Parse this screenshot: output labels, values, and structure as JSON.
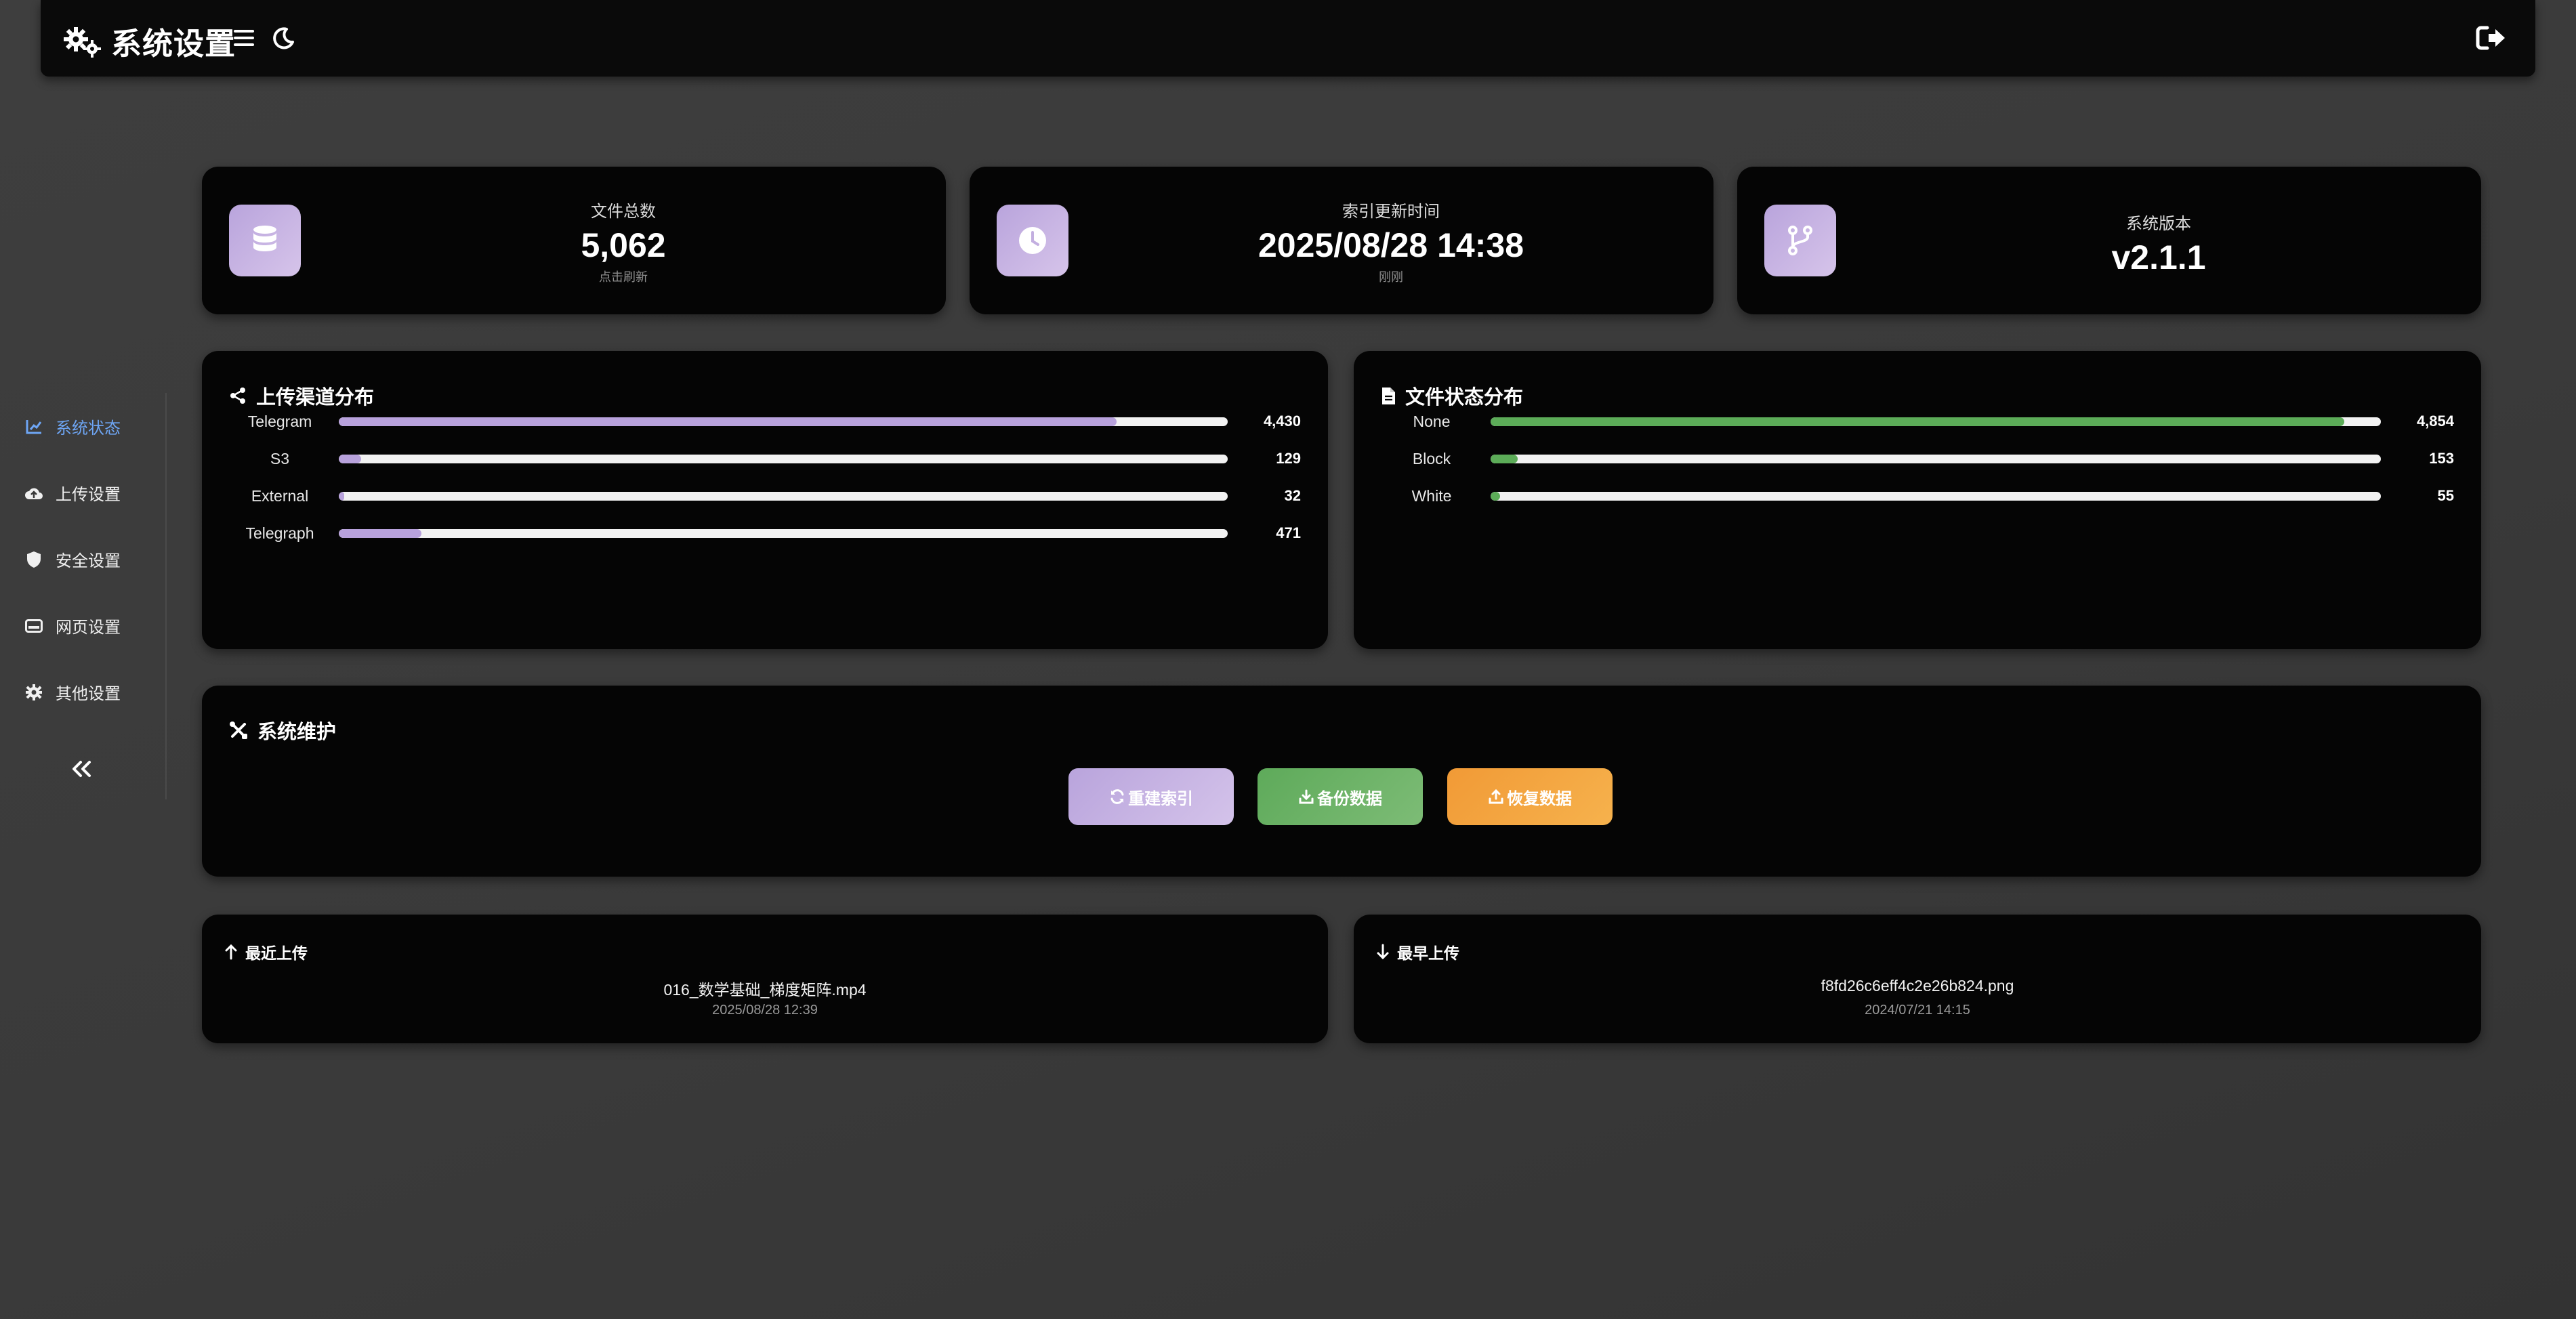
{
  "header": {
    "title": "系统设置",
    "gears_icon": "gears-icon",
    "menu_icon": "menu-icon",
    "theme_icon": "moon-icon",
    "logout_icon": "logout-icon"
  },
  "sidebar": {
    "items": [
      {
        "label": "系统状态",
        "icon": "chart-icon",
        "active": true
      },
      {
        "label": "上传设置",
        "icon": "cloud-upload-icon",
        "active": false
      },
      {
        "label": "安全设置",
        "icon": "shield-icon",
        "active": false
      },
      {
        "label": "网页设置",
        "icon": "window-icon",
        "active": false
      },
      {
        "label": "其他设置",
        "icon": "gear-icon",
        "active": false
      }
    ],
    "collapse_icon": "double-chevron-left-icon"
  },
  "stats": [
    {
      "label": "文件总数",
      "value": "5,062",
      "sub": "点击刷新",
      "icon": "database-icon"
    },
    {
      "label": "索引更新时间",
      "value": "2025/08/28 14:38",
      "sub": "刚刚",
      "icon": "clock-icon"
    },
    {
      "label": "系统版本",
      "value": "v2.1.1",
      "sub": "",
      "icon": "branch-icon"
    }
  ],
  "upload_channels": {
    "title": "上传渠道分布",
    "max": 5062,
    "color": "#b8a2dc",
    "rows": [
      {
        "label": "Telegram",
        "value": 4430,
        "display": "4,430"
      },
      {
        "label": "S3",
        "value": 129,
        "display": "129"
      },
      {
        "label": "External",
        "value": 32,
        "display": "32"
      },
      {
        "label": "Telegraph",
        "value": 471,
        "display": "471"
      }
    ]
  },
  "file_status": {
    "title": "文件状态分布",
    "max": 5062,
    "color": "#5cac58",
    "rows": [
      {
        "label": "None",
        "value": 4854,
        "display": "4,854"
      },
      {
        "label": "Block",
        "value": 153,
        "display": "153"
      },
      {
        "label": "White",
        "value": 55,
        "display": "55"
      }
    ]
  },
  "maintenance": {
    "title": "系统维护",
    "buttons": [
      {
        "label": "重建索引",
        "icon": "refresh-icon",
        "color": "#c3afe0"
      },
      {
        "label": "备份数据",
        "icon": "download-icon",
        "color": "#6fb36a"
      },
      {
        "label": "恢复数据",
        "icon": "upload-icon",
        "color": "#f3a640"
      }
    ]
  },
  "recent_upload": {
    "title": "最近上传",
    "name": "016_数学基础_梯度矩阵.mp4",
    "time": "2025/08/28 12:39"
  },
  "earliest_upload": {
    "title": "最早上传",
    "name": "f8fd26c6eff4c2e26b824.png",
    "time": "2024/07/21 14:15"
  }
}
